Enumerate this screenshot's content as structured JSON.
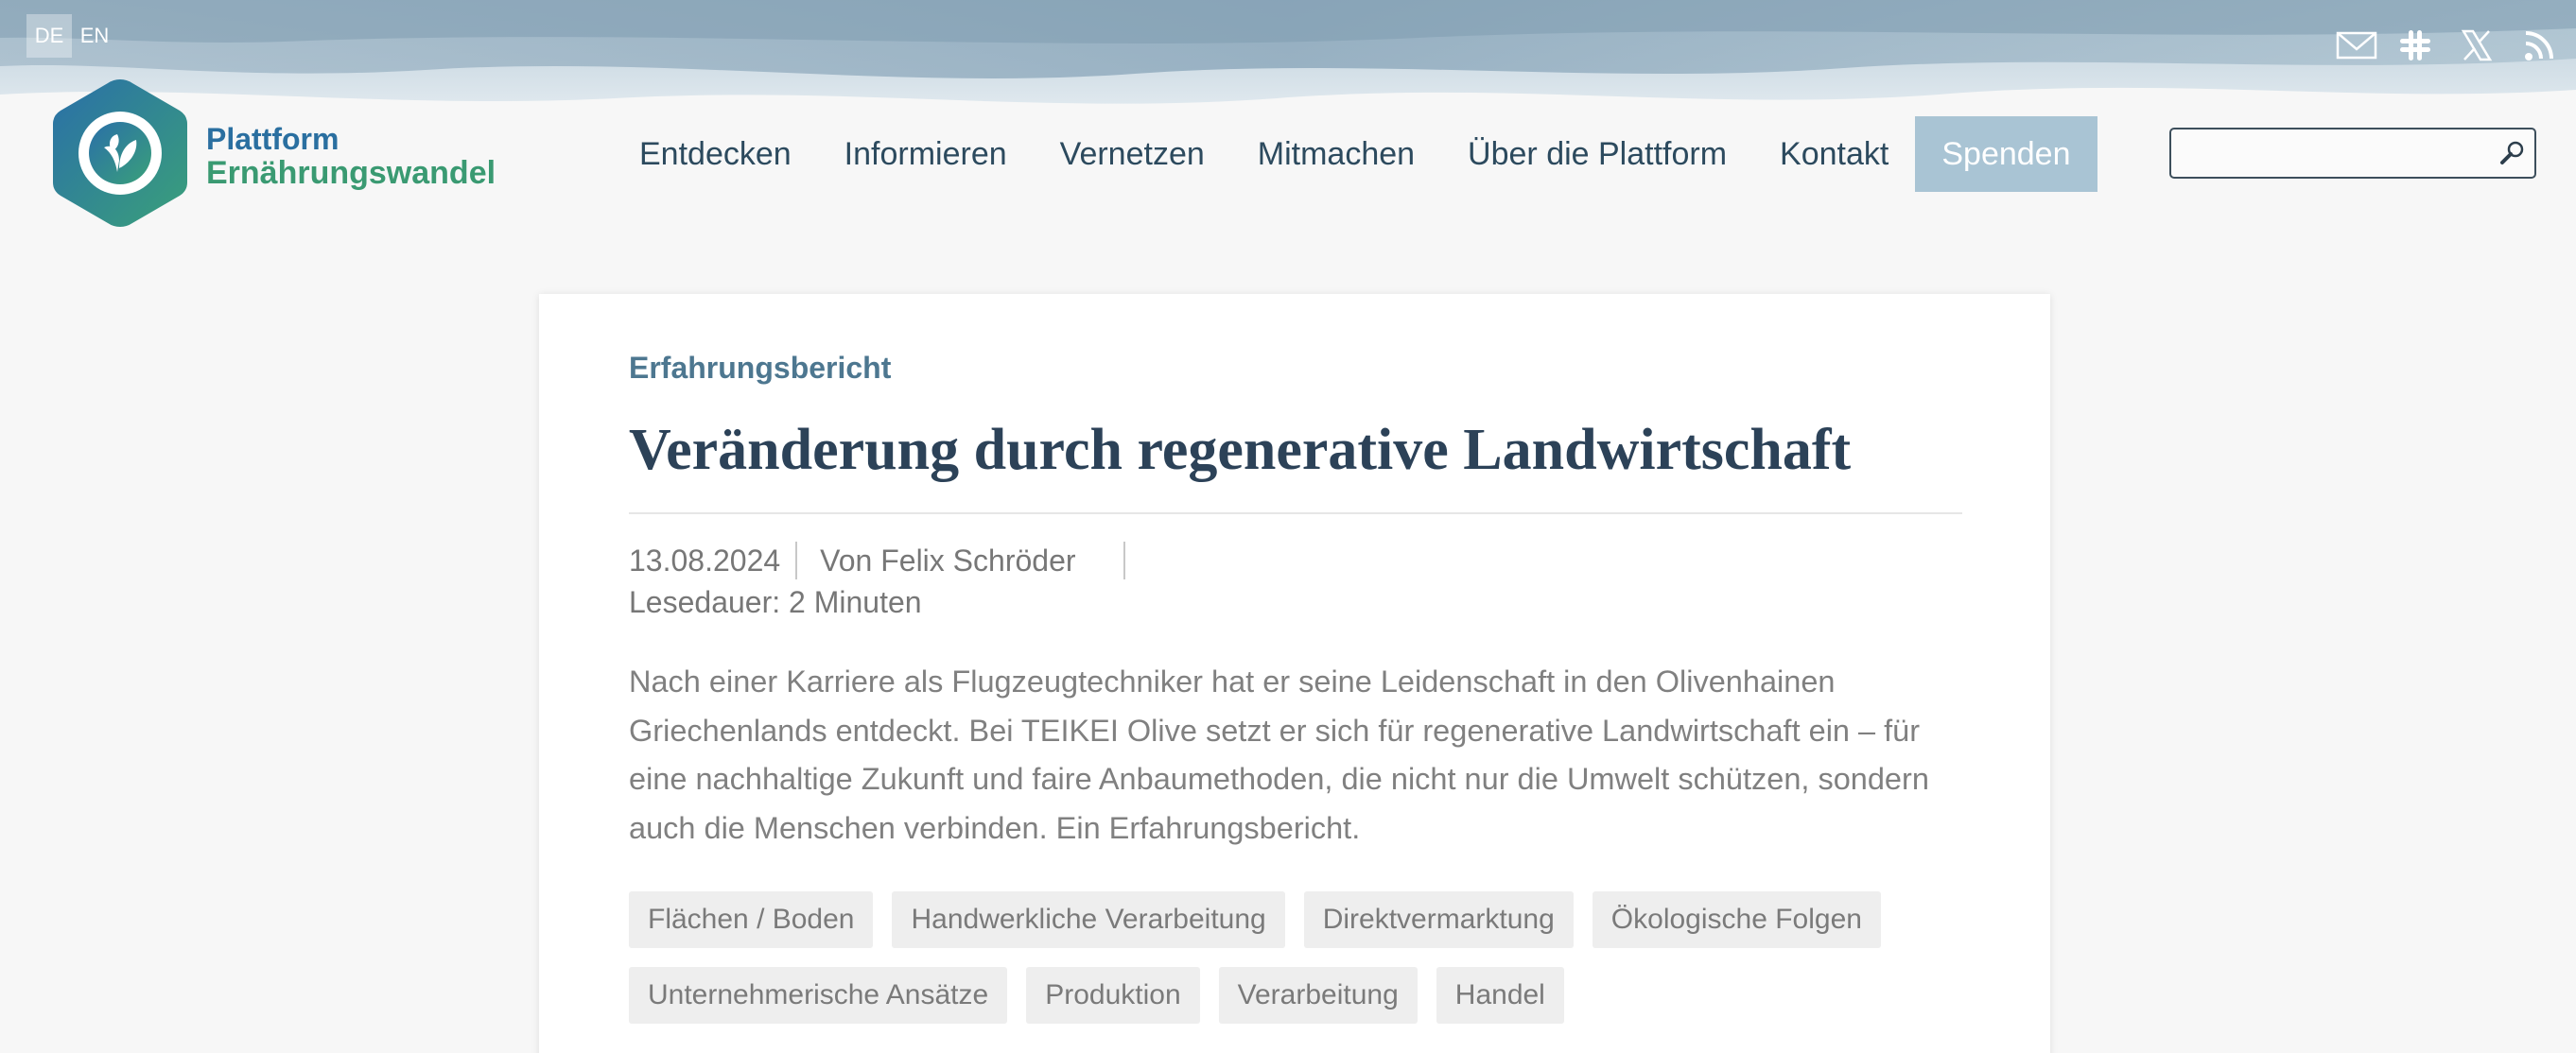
{
  "colors": {
    "accent": "#a9c4d4",
    "brand_blue": "#2a6fa0",
    "brand_green": "#3a9a72",
    "heading": "#2c4258",
    "category": "#4d7790"
  },
  "languages": {
    "de": "DE",
    "en": "EN",
    "active": "DE"
  },
  "social_icons": [
    "mail-icon",
    "slack-icon",
    "x-icon",
    "rss-icon"
  ],
  "logo": {
    "line1": "Plattform",
    "line2": "Ernährungswandel",
    "icon": "leaf-hexagon-icon"
  },
  "nav": {
    "items": [
      {
        "label": "Entdecken"
      },
      {
        "label": "Informieren"
      },
      {
        "label": "Vernetzen"
      },
      {
        "label": "Mitmachen"
      },
      {
        "label": "Über die Plattform"
      },
      {
        "label": "Kontakt"
      }
    ],
    "donate_label": "Spenden"
  },
  "search": {
    "value": "",
    "placeholder": "",
    "icon": "search-icon"
  },
  "article": {
    "category": "Erfahrungsbericht",
    "title": "Veränderung durch regenerative Landwirtschaft",
    "date": "13.08.2024",
    "author": "Von Felix Schröder",
    "reading_time": "Lesedauer: 2 Minuten",
    "lead": "Nach einer Karriere als Flugzeugtechniker hat er seine Leidenschaft in den Olivenhainen Griechenlands entdeckt. Bei TEIKEI Olive setzt er sich für regenerative Landwirtschaft ein – für eine nachhaltige Zukunft und faire Anbaumethoden, die nicht nur die Umwelt schützen, sondern auch die Menschen verbinden. Ein Erfahrungsbericht.",
    "tags": [
      "Flächen / Boden",
      "Handwerkliche Verarbeitung",
      "Direktvermarktung",
      "Ökologische Folgen",
      "Unternehmerische Ansätze",
      "Produktion",
      "Verarbeitung",
      "Handel"
    ]
  }
}
